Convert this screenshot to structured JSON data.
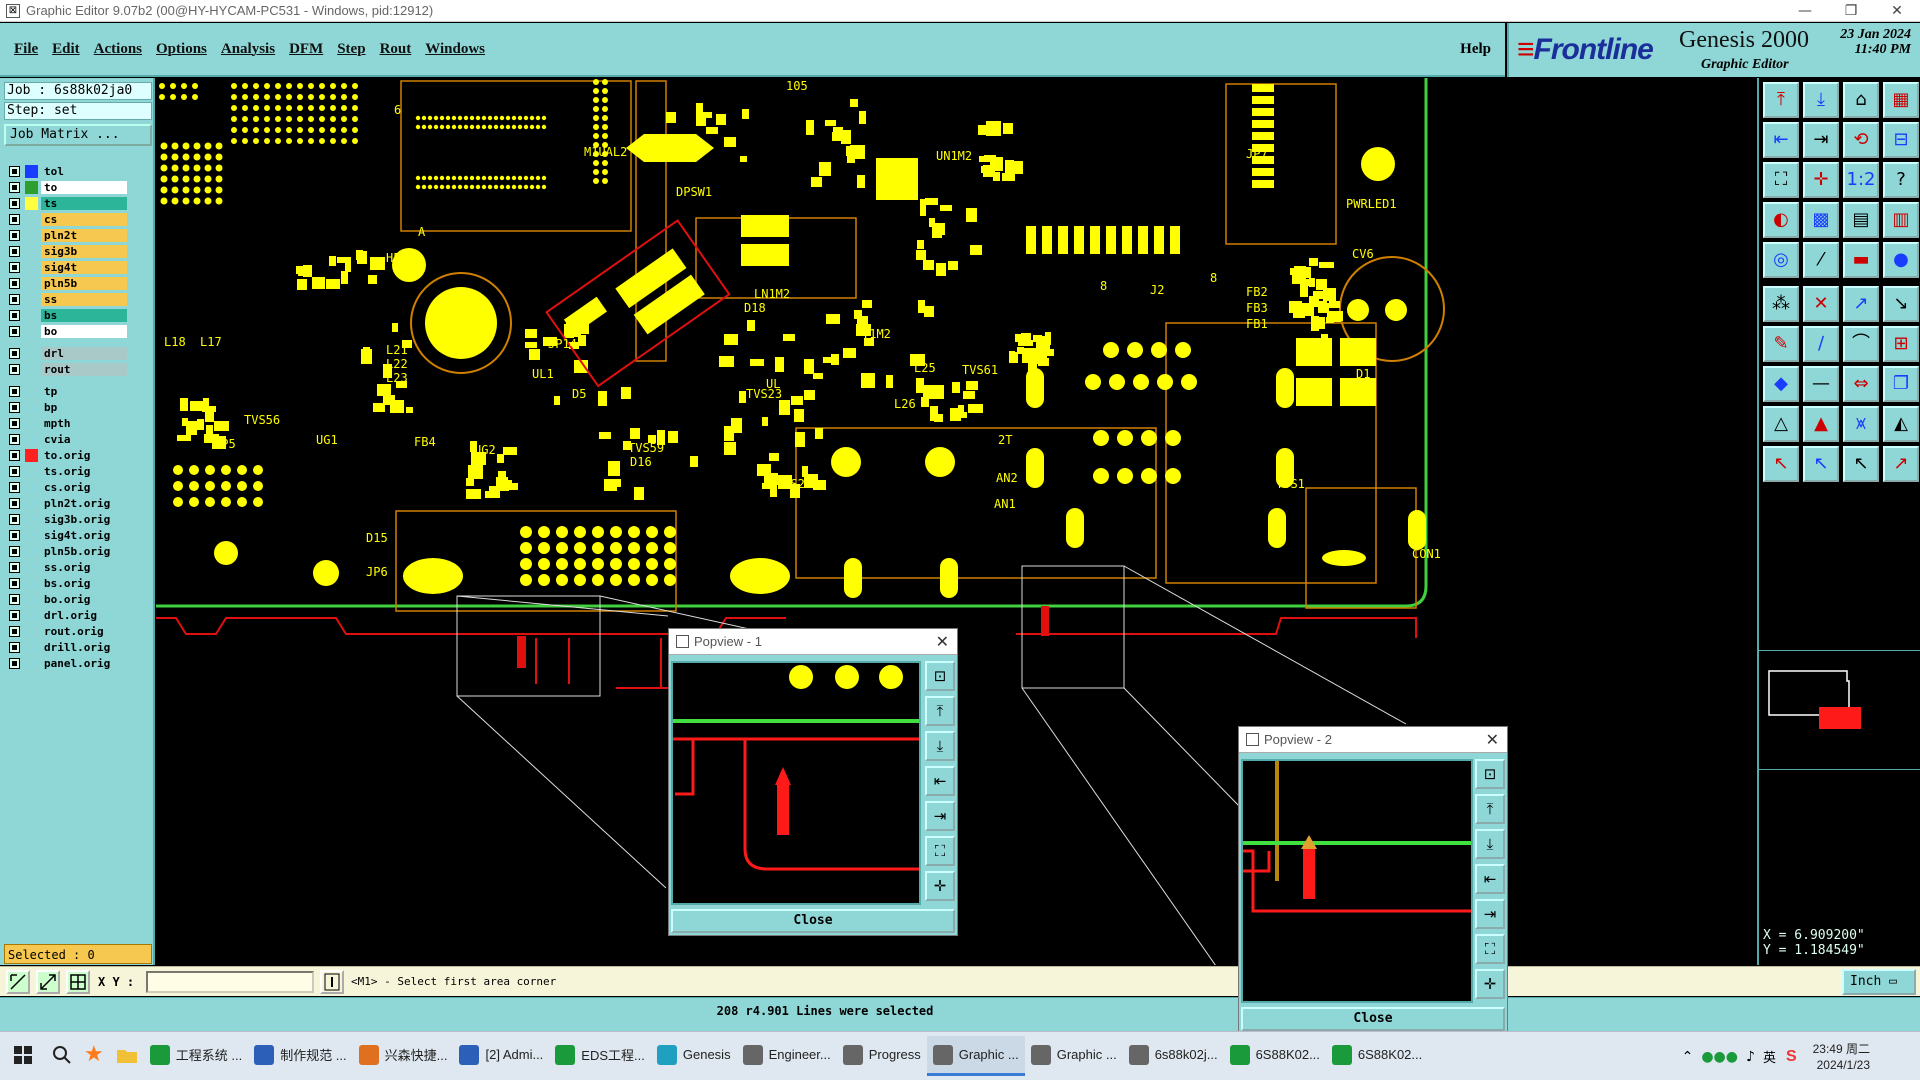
{
  "window": {
    "title": "Graphic Editor 9.07b2 (00@HY-HYCAM-PC531 - Windows, pid:12912)",
    "icon": "app-icon",
    "controls": [
      "—",
      "❐",
      "✕"
    ]
  },
  "menu": {
    "items": [
      "File",
      "Edit",
      "Actions",
      "Options",
      "Analysis",
      "DFM",
      "Step",
      "Rout",
      "Windows"
    ],
    "help": "Help"
  },
  "brand": {
    "logo": "Frontline",
    "product": "Genesis 2000",
    "subtitle": "Graphic Editor",
    "date": "23 Jan 2024",
    "time": "11:40 PM"
  },
  "job": {
    "job_label": "Job  : 6s88k02ja0",
    "step_label": "Step: set",
    "matrix_button": "Job Matrix ..."
  },
  "layers": [
    {
      "name": "tol",
      "color": "#1a3cff",
      "bg": "#8fd6d6"
    },
    {
      "name": "to",
      "color": "#2e9e2e",
      "bg": "#ffffff"
    },
    {
      "name": "ts",
      "color": "#ffff40",
      "bg": "#2db59a"
    },
    {
      "name": "cs",
      "color": "",
      "bg": "#f6c84f"
    },
    {
      "name": "pln2t",
      "color": "",
      "bg": "#f6c84f"
    },
    {
      "name": "sig3b",
      "color": "",
      "bg": "#f6c84f"
    },
    {
      "name": "sig4t",
      "color": "",
      "bg": "#f6c84f"
    },
    {
      "name": "pln5b",
      "color": "",
      "bg": "#f6c84f"
    },
    {
      "name": "ss",
      "color": "",
      "bg": "#f6c84f"
    },
    {
      "name": "bs",
      "color": "",
      "bg": "#2db59a"
    },
    {
      "name": "bo",
      "color": "",
      "bg": "#ffffff"
    },
    {
      "name": "drl",
      "color": "",
      "bg": "#a9c9c9"
    },
    {
      "name": "rout",
      "color": "",
      "bg": "#a9c9c9"
    },
    {
      "name": "tp",
      "color": "",
      "bg": "#8fd6d6"
    },
    {
      "name": "bp",
      "color": "",
      "bg": "#8fd6d6"
    },
    {
      "name": "mpth",
      "color": "",
      "bg": "#8fd6d6"
    },
    {
      "name": "cvia",
      "color": "",
      "bg": "#8fd6d6"
    },
    {
      "name": "to.orig",
      "color": "#ff2020",
      "bg": "#8fd6d6"
    },
    {
      "name": "ts.orig",
      "color": "",
      "bg": "#8fd6d6"
    },
    {
      "name": "cs.orig",
      "color": "",
      "bg": "#8fd6d6"
    },
    {
      "name": "pln2t.orig",
      "color": "",
      "bg": "#8fd6d6"
    },
    {
      "name": "sig3b.orig",
      "color": "",
      "bg": "#8fd6d6"
    },
    {
      "name": "sig4t.orig",
      "color": "",
      "bg": "#8fd6d6"
    },
    {
      "name": "pln5b.orig",
      "color": "",
      "bg": "#8fd6d6"
    },
    {
      "name": "ss.orig",
      "color": "",
      "bg": "#8fd6d6"
    },
    {
      "name": "bs.orig",
      "color": "",
      "bg": "#8fd6d6"
    },
    {
      "name": "bo.orig",
      "color": "",
      "bg": "#8fd6d6"
    },
    {
      "name": "drl.orig",
      "color": "",
      "bg": "#8fd6d6"
    },
    {
      "name": "rout.orig",
      "color": "",
      "bg": "#8fd6d6"
    },
    {
      "name": "drill.orig",
      "color": "",
      "bg": "#8fd6d6"
    },
    {
      "name": "panel.orig",
      "color": "",
      "bg": "#8fd6d6"
    }
  ],
  "selected_label": "Selected : 0",
  "board_labels": [
    "DPSW1",
    "H5",
    "JP14",
    "L21",
    "L22",
    "L23",
    "UL1",
    "TVS56",
    "UG1",
    "JP5",
    "FB4",
    "UG2",
    "D15",
    "JP6",
    "LN1M2",
    "D18",
    "Y1M2",
    "L25",
    "TVS61",
    "TVS59",
    "D16",
    "D5",
    "TVS23",
    "TVS24",
    "AN2",
    "AN1",
    "M1UAL2",
    "UN1M2",
    "PWRLED1",
    "JP7",
    "FB2",
    "FB3",
    "FB1",
    "CV6",
    "J2",
    "D1",
    "TVS1",
    "CON1",
    "L17",
    "L18",
    "105",
    "8",
    "6",
    "A",
    "8",
    "2T",
    "L26",
    "UL"
  ],
  "popview1": {
    "title": "Popview - 1",
    "close": "Close"
  },
  "popview2": {
    "title": "Popview - 2",
    "close": "Close"
  },
  "coords": {
    "x": "X = 6.909200\"",
    "y": "Y = 1.184549\""
  },
  "bottom": {
    "xy_label": "X Y :",
    "xy_value": "",
    "prompt": "<M1> - Select first area corner",
    "unit": "Inch"
  },
  "status": "208 r4.901 Lines were selected",
  "taskbar": {
    "items": [
      {
        "label": "工程系统 ...",
        "color": "#1a9a3a"
      },
      {
        "label": "制作规范 ...",
        "color": "#2b5fb8"
      },
      {
        "label": "兴森快捷...",
        "color": "#e07020"
      },
      {
        "label": "[2] Admi...",
        "color": "#2b5fb8"
      },
      {
        "label": "EDS工程...",
        "color": "#1a9a3a"
      },
      {
        "label": "Genesis",
        "color": "#20a0c0"
      },
      {
        "label": "Engineer...",
        "color": "#666666"
      },
      {
        "label": "Progress",
        "color": "#666666"
      },
      {
        "label": "Graphic ...",
        "color": "#666666"
      },
      {
        "label": "Graphic ...",
        "color": "#666666"
      },
      {
        "label": "6s88k02j...",
        "color": "#666666"
      },
      {
        "label": "6S88K02...",
        "color": "#1a9a3a"
      },
      {
        "label": "6S88K02...",
        "color": "#1a9a3a"
      }
    ],
    "clock_time": "23:49 周二",
    "clock_date": "2024/1/23",
    "ime": "英"
  }
}
